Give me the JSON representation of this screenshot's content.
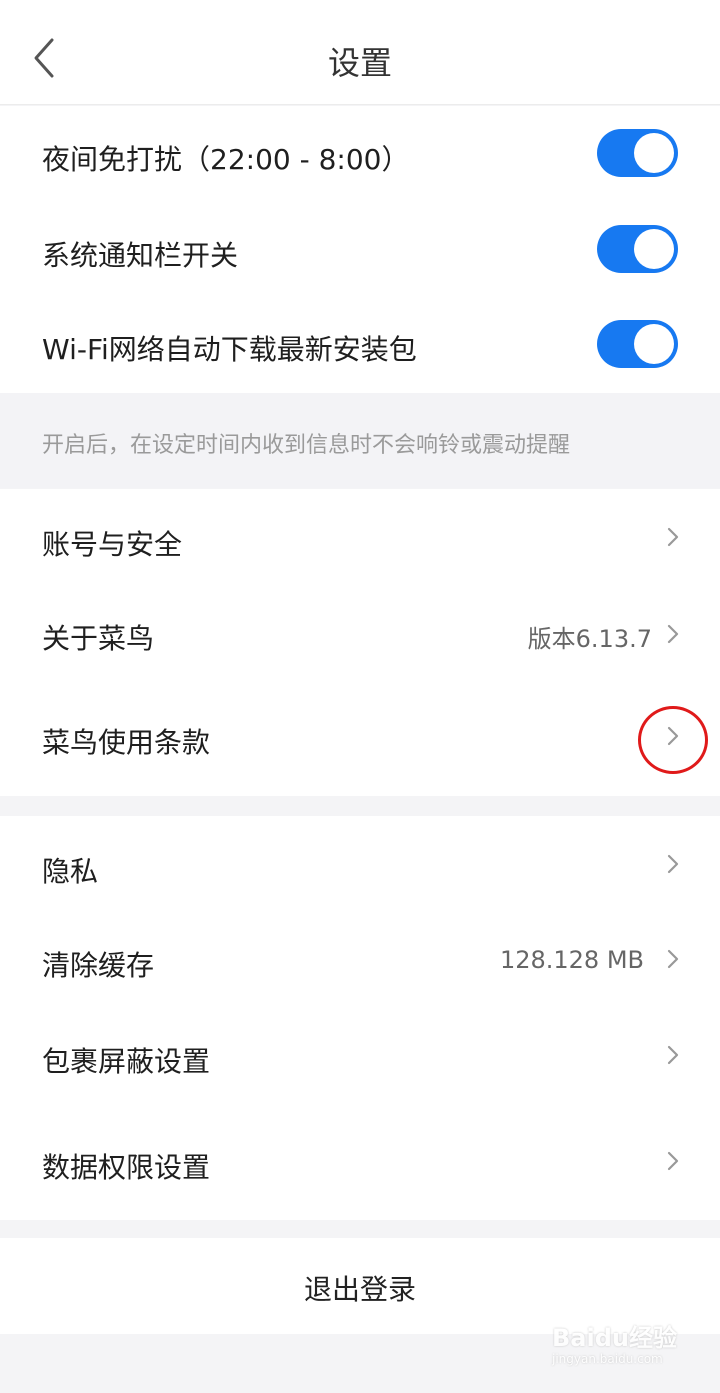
{
  "header": {
    "title": "设置",
    "back_icon": "chevron-left-icon"
  },
  "toggles": [
    {
      "label": "夜间免打扰（22:00 - 8:00）",
      "on": true
    },
    {
      "label": "系统通知栏开关",
      "on": true
    },
    {
      "label": "Wi-Fi网络自动下载最新安装包",
      "on": true
    }
  ],
  "hint": "开启后，在设定时间内收到信息时不会响铃或震动提醒",
  "account_group": [
    {
      "label": "账号与安全",
      "value": ""
    },
    {
      "label": "关于菜鸟",
      "value": "版本6.13.7"
    },
    {
      "label": "菜鸟使用条款",
      "value": ""
    }
  ],
  "privacy_group": [
    {
      "label": "隐私",
      "value": ""
    },
    {
      "label": "清除缓存",
      "value": "128.128 MB"
    },
    {
      "label": "包裹屏蔽设置",
      "value": ""
    },
    {
      "label": "数据权限设置",
      "value": ""
    }
  ],
  "logout_label": "退出登录",
  "watermark": {
    "brand": "Baidu经验",
    "url": "jingyan.baidu.com"
  },
  "colors": {
    "accent": "#1779f1",
    "highlight": "#e01a1a",
    "background": "#f4f4f6"
  }
}
